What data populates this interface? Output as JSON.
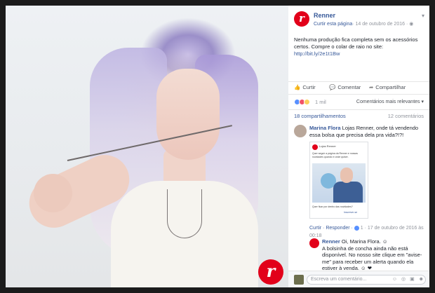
{
  "post": {
    "page_name": "Renner",
    "logo_letter": "r",
    "like_page": "Curtir esta página",
    "date": "· 14 de outubro de 2016 · ",
    "globe_icon": "globe-icon",
    "text_main": "Nenhuma produção fica completa sem os acessórios certos. Compre o colar de raio no site: ",
    "text_link": "http://bit.ly/2e1t1Bw"
  },
  "actions": {
    "like": "Curtir",
    "comment": "Comentar",
    "share": "Compartilhar",
    "like_icon": "thumbs-up-icon",
    "comment_icon": "speech-bubble-icon",
    "share_icon": "share-arrow-icon"
  },
  "reactions": {
    "count": "1 mil",
    "relevance": "Comentários mais relevantes ▾"
  },
  "stats": {
    "shares": "18 compartilhamentos",
    "comments": "12 comentários"
  },
  "comments": [
    {
      "name": "Marina Flora",
      "text": " Lojas Renner, onde tá vendendo essa bolsa que precisa dela pra vida?!?!",
      "meta_actions": "Curtir · Responder · ",
      "meta_count": "1",
      "meta_date": " · 17 de outubro de 2016 às 00:18"
    }
  ],
  "attachment": {
    "title": "Lojas Renner",
    "text": "Quer seguir a página da Renner e nossas novidades quando e onde quiser.",
    "footer": "Quer ficar por dentro das novidades?",
    "button": "Inscrever-se"
  },
  "reply": {
    "name": "Renner",
    "greeting": " Oi, Marina Flora.",
    "emoji": "☺",
    "text": "A bolsinha de concha ainda não está disponível. No nosso site clique em \"avise-me\" para receber um alerta quando ela estiver à venda.",
    "emoji2": "☺ ❤"
  },
  "write": {
    "placeholder": "Escreva um comentário...",
    "icons": "☺ ◎ ▣ ☻"
  },
  "colors": {
    "brand": "#e2001a",
    "link": "#365899",
    "muted": "#90949c"
  }
}
